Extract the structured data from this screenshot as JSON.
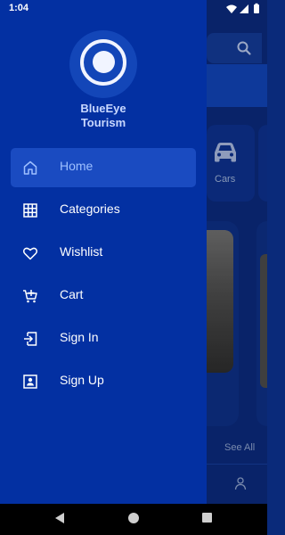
{
  "status_bar": {
    "time": "1:04",
    "icons": [
      "wifi-icon",
      "signal-icon",
      "battery-icon"
    ]
  },
  "background_screen": {
    "search_icon": "search-icon",
    "category_card_label": "Cars",
    "see_all_label": "See All",
    "profile_icon": "person-icon"
  },
  "drawer": {
    "logo_icon": "eye-logo-icon",
    "brand_line1": "BlueEye",
    "brand_line2": "Tourism",
    "menu_items": [
      {
        "label": "Home",
        "icon": "home-icon",
        "active": true
      },
      {
        "label": "Categories",
        "icon": "grid-icon",
        "active": false
      },
      {
        "label": "Wishlist",
        "icon": "heart-icon",
        "active": false
      },
      {
        "label": "Cart",
        "icon": "cart-icon",
        "active": false
      },
      {
        "label": "Sign In",
        "icon": "sign-in-icon",
        "active": false
      },
      {
        "label": "Sign Up",
        "icon": "sign-up-icon",
        "active": false
      }
    ]
  },
  "navigation_bar": {
    "buttons": [
      "back-icon",
      "home-circle-icon",
      "recents-icon"
    ]
  },
  "colors": {
    "drawer_bg": "#0330a2",
    "active_item_bg": "#1a4bc1",
    "active_label": "#9ec0ff",
    "app_bg": "#0b2a7c",
    "text": "#ffffff"
  }
}
